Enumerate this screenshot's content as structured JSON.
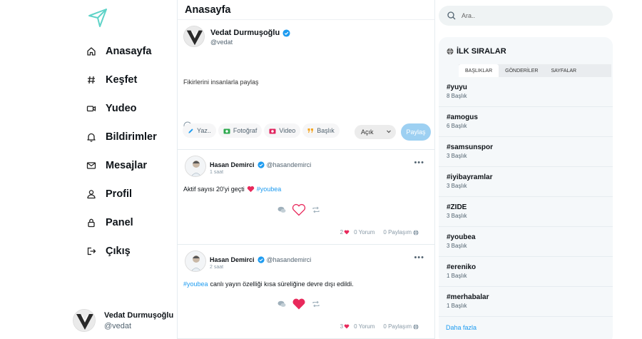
{
  "nav": {
    "items": [
      {
        "label": "Anasayfa",
        "icon": "home-icon"
      },
      {
        "label": "Keşfet",
        "icon": "hashtag-icon"
      },
      {
        "label": "Yudeo",
        "icon": "video-icon"
      },
      {
        "label": "Bildirimler",
        "icon": "bell-icon"
      },
      {
        "label": "Mesajlar",
        "icon": "mail-icon"
      },
      {
        "label": "Profil",
        "icon": "user-icon"
      },
      {
        "label": "Panel",
        "icon": "lock-icon"
      },
      {
        "label": "Çıkış",
        "icon": "logout-icon"
      }
    ]
  },
  "current_user": {
    "name": "Vedat Durmuşoğlu",
    "handle": "@vedat"
  },
  "main": {
    "title": "Anasayfa",
    "composer": {
      "name": "Vedat Durmuşoğlu",
      "handle": "@vedat",
      "placeholder": "Fikirlerini insanlarla paylaş",
      "tools": [
        "Yaz..",
        "Fotoğraf",
        "Video",
        "Başlık"
      ],
      "visibility": "Açık",
      "share_label": "Paylaş"
    },
    "posts": [
      {
        "name": "Hasan Demirci",
        "handle": "@hasandemirci",
        "time": "1 saat",
        "text": "Aktif sayısı 20'yi geçti",
        "tag": "#youbea",
        "liked": false,
        "likes": "2",
        "comments": "0 Yorum",
        "shares": "0 Paylaşım"
      },
      {
        "name": "Hasan Demirci",
        "handle": "@hasandemirci",
        "time": "2 saat",
        "tag": "#youbea",
        "text": "canlı yayın özelliği kısa süreliğine devre dışı edildi.",
        "liked": true,
        "likes": "3",
        "comments": "0 Yorum",
        "shares": "0 Paylaşım"
      }
    ]
  },
  "search": {
    "placeholder": "Ara.."
  },
  "trends": {
    "title": "İLK SIRALAR",
    "tabs": [
      "BAŞLIKLAR",
      "GÖNDERİLER",
      "SAYFALAR"
    ],
    "items": [
      {
        "tag": "#yuyu",
        "count": "8 Başlık"
      },
      {
        "tag": "#amogus",
        "count": "6 Başlık"
      },
      {
        "tag": "#samsunspor",
        "count": "3 Başlık"
      },
      {
        "tag": "#iyibayramlar",
        "count": "3 Başlık"
      },
      {
        "tag": "#ZIDE",
        "count": "3 Başlık"
      },
      {
        "tag": "#youbea",
        "count": "3 Başlık"
      },
      {
        "tag": "#ereniko",
        "count": "1 Başlık"
      },
      {
        "tag": "#merhabalar",
        "count": "1 Başlık"
      }
    ],
    "more": "Daha fazla"
  },
  "colors": {
    "accent": "#1d9bf0",
    "heart": "#e8295b",
    "logo": "#5fd3c8"
  }
}
